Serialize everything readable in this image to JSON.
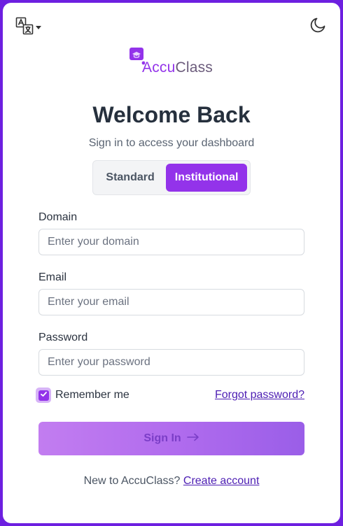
{
  "header": {
    "language_icon": "translate-icon",
    "dropdown_icon": "caret-down-icon",
    "theme_icon": "moon-icon"
  },
  "brand": {
    "name_part1": "Accu",
    "name_part2": "Class",
    "logo_icon": "graduation-cap-chat-icon",
    "accent_color": "#9333ea"
  },
  "title": "Welcome Back",
  "subtitle": "Sign in to access your dashboard",
  "tabs": {
    "standard": "Standard",
    "institutional": "Institutional",
    "active": "Institutional"
  },
  "form": {
    "domain_label": "Domain",
    "domain_placeholder": "Enter your domain",
    "email_label": "Email",
    "email_placeholder": "Enter your email",
    "password_label": "Password",
    "password_placeholder": "Enter your password",
    "remember_label": "Remember me",
    "remember_checked": true,
    "forgot_link": "Forgot password?",
    "submit_label": "Sign In",
    "submit_icon": "arrow-right-icon"
  },
  "footer": {
    "prompt": "New to AccuClass?",
    "link": "Create account"
  }
}
